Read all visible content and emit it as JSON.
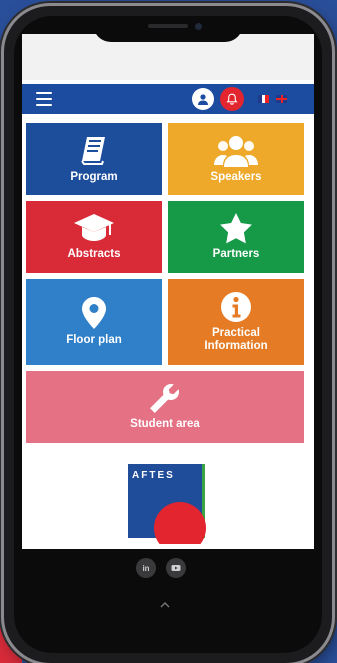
{
  "topbar": {
    "menu_icon": "hamburger-icon",
    "user_icon": "user-icon",
    "notification_icon": "bell-icon",
    "languages": [
      "fr",
      "en"
    ]
  },
  "tiles": {
    "program": {
      "label": "Program",
      "icon": "book-icon",
      "color": "#1d4e9c"
    },
    "speakers": {
      "label": "Speakers",
      "icon": "people-icon",
      "color": "#efa92a"
    },
    "abstracts": {
      "label": "Abstracts",
      "icon": "graduation-cap-icon",
      "color": "#d92a37"
    },
    "partners": {
      "label": "Partners",
      "icon": "star-icon",
      "color": "#169a48"
    },
    "floor_plan": {
      "label": "Floor plan",
      "icon": "map-pin-icon",
      "color": "#2f7fc9"
    },
    "practical_line1": "Practical",
    "practical_line2": "Information",
    "practical_icon": "info-icon",
    "practical_color": "#e57b24",
    "student": {
      "label": "Student area",
      "icon": "wrench-icon",
      "color": "#e57185"
    }
  },
  "logo": {
    "text": "AFTES"
  },
  "footer": {
    "linkedin": "in",
    "youtube_icon": "youtube-icon",
    "scroll_top_icon": "chevron-up-icon"
  }
}
